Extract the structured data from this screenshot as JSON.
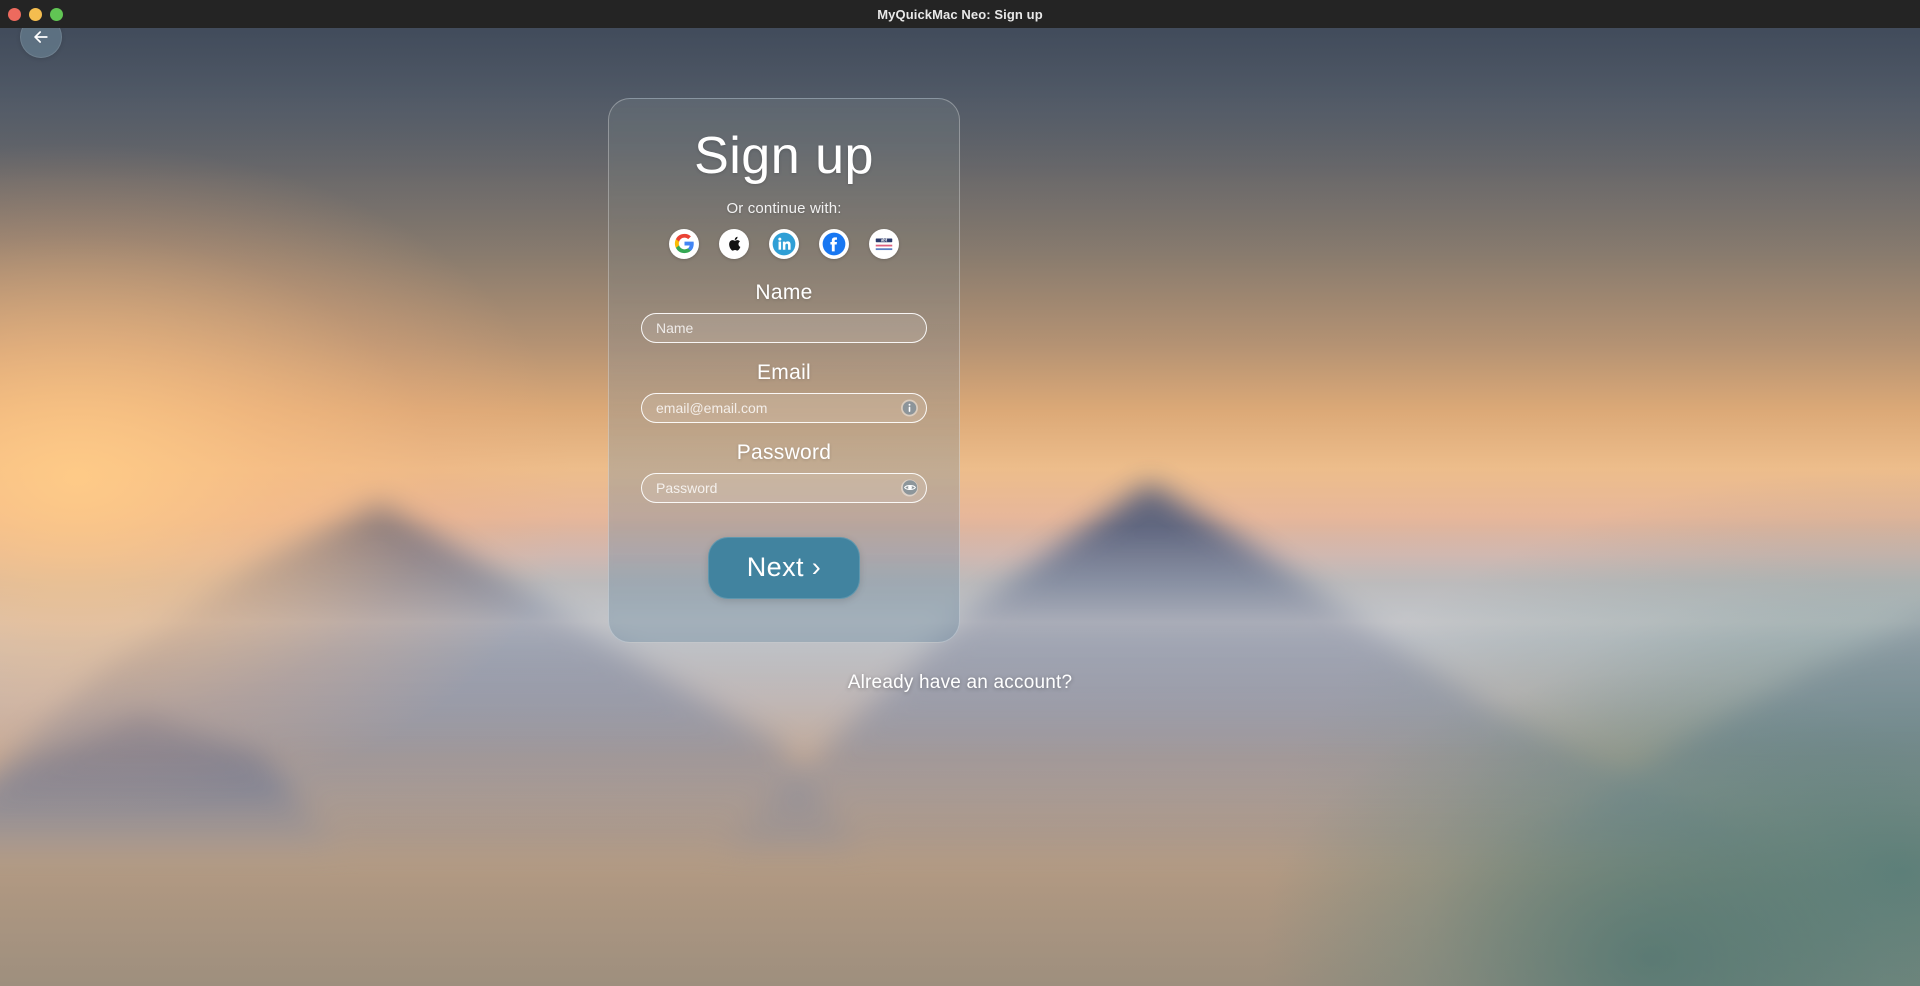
{
  "window": {
    "title": "MyQuickMac Neo: Sign up",
    "traffic_lights": [
      {
        "name": "close",
        "color": "#ed6a5e"
      },
      {
        "name": "minimize",
        "color": "#f4bd4f"
      },
      {
        "name": "maximize",
        "color": "#61c554"
      }
    ]
  },
  "nav": {
    "back_icon": "arrow-left-icon",
    "back_label": "Back"
  },
  "card": {
    "title": "Sign up",
    "continue_with_label": "Or continue with:",
    "social_providers": [
      {
        "id": "google",
        "icon": "google-icon",
        "label": "Google"
      },
      {
        "id": "apple",
        "icon": "apple-icon",
        "label": "Apple"
      },
      {
        "id": "linkedin",
        "icon": "linkedin-icon",
        "label": "LinkedIn"
      },
      {
        "id": "facebook",
        "icon": "facebook-icon",
        "label": "Facebook"
      },
      {
        "id": "abt",
        "icon": "abt-icon",
        "label": "abt"
      }
    ],
    "fields": [
      {
        "id": "name",
        "label": "Name",
        "placeholder": "Name",
        "value": "",
        "type": "text",
        "adornment": null
      },
      {
        "id": "email",
        "label": "Email",
        "placeholder": "email@email.com",
        "value": "",
        "type": "email",
        "adornment": "info-icon"
      },
      {
        "id": "password",
        "label": "Password",
        "placeholder": "Password",
        "value": "",
        "type": "password",
        "adornment": "eye-icon"
      }
    ],
    "submit_label": "Next ›"
  },
  "footer": {
    "account_link": "Already have an account?"
  },
  "colors": {
    "titlebar_bg": "#242424",
    "titlebar_text": "#e8e8e8",
    "next_button_bg": "#41839f",
    "card_border": "rgba(255,255,255,0.30)",
    "input_border": "rgba(255,255,255,0.92)",
    "back_button_bg": "rgba(108,134,152,0.62)",
    "google_blue": "#4285F4",
    "google_green": "#34A853",
    "google_yellow": "#FBBC05",
    "google_red": "#EA4335",
    "linkedin_blue": "#0A66C2",
    "facebook_blue": "#1877F2",
    "apple_black": "#111111"
  }
}
